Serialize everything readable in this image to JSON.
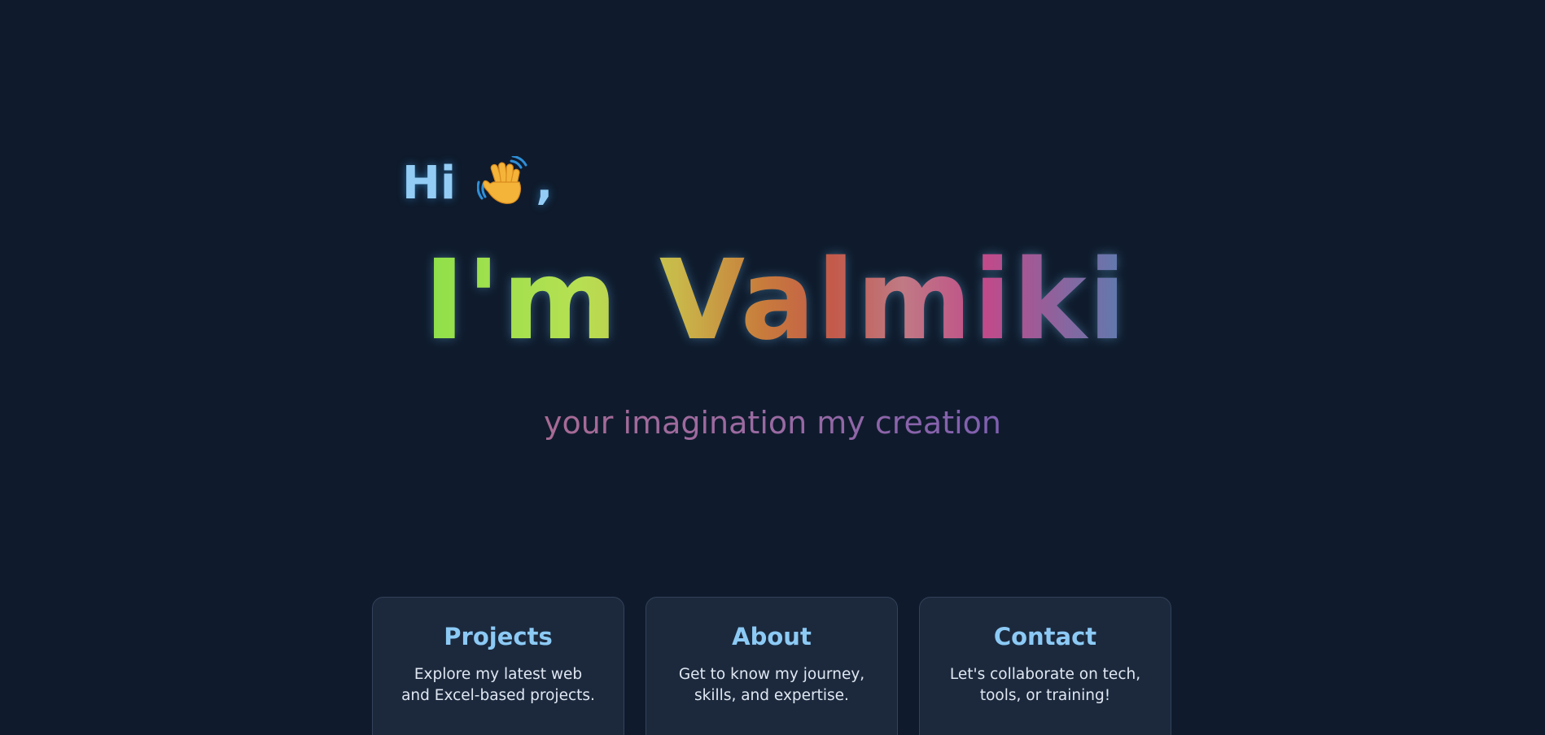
{
  "hero": {
    "greeting": "Hi",
    "greeting_suffix": ",",
    "headline": "I'm Valmiki",
    "tagline": "your imagination my creation"
  },
  "cards": [
    {
      "title": "Projects",
      "description": "Explore my latest web and Excel-based projects."
    },
    {
      "title": "About",
      "description": "Get to know my journey, skills, and expertise."
    },
    {
      "title": "Contact",
      "description": "Let's collaborate on tech, tools, or training!"
    }
  ],
  "colors": {
    "background": "#0f1b2d",
    "card_background": "#1c293d",
    "card_border": "#33415a",
    "accent": "#8ccaf5",
    "greeting": "#93cdf6"
  },
  "icons": {
    "wave": "waving-hand-icon"
  }
}
